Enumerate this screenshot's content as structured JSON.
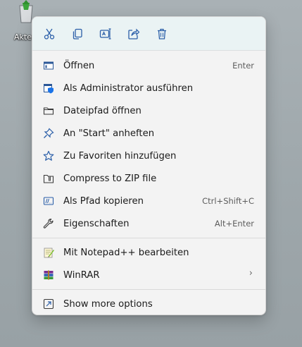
{
  "desktop_icon": {
    "label": "Akten"
  },
  "quick_actions": [
    {
      "icon": "cut-icon",
      "name": "cut"
    },
    {
      "icon": "copy-icon",
      "name": "copy"
    },
    {
      "icon": "rename-icon",
      "name": "rename"
    },
    {
      "icon": "share-icon",
      "name": "share"
    },
    {
      "icon": "delete-icon",
      "name": "delete"
    }
  ],
  "menu": {
    "group1": [
      {
        "id": "open",
        "label": "Öffnen",
        "shortcut": "Enter",
        "icon": "open-window-icon"
      },
      {
        "id": "run-as-admin",
        "label": "Als Administrator ausführen",
        "shortcut": "",
        "icon": "admin-shield-icon"
      },
      {
        "id": "open-file-path",
        "label": "Dateipfad öffnen",
        "shortcut": "",
        "icon": "folder-icon"
      },
      {
        "id": "pin-start",
        "label": "An \"Start\" anheften",
        "shortcut": "",
        "icon": "pin-icon"
      },
      {
        "id": "add-favorites",
        "label": "Zu Favoriten hinzufügen",
        "shortcut": "",
        "icon": "star-icon"
      },
      {
        "id": "compress-zip",
        "label": "Compress to ZIP file",
        "shortcut": "",
        "icon": "zip-folder-icon"
      },
      {
        "id": "copy-path",
        "label": "Als Pfad kopieren",
        "shortcut": "Ctrl+Shift+C",
        "icon": "copy-path-icon"
      },
      {
        "id": "properties",
        "label": "Eigenschaften",
        "shortcut": "Alt+Enter",
        "icon": "wrench-icon"
      }
    ],
    "group2": [
      {
        "id": "notepadpp",
        "label": "Mit Notepad++ bearbeiten",
        "shortcut": "",
        "icon": "notepadpp-icon"
      },
      {
        "id": "winrar",
        "label": "WinRAR",
        "shortcut": "",
        "icon": "winrar-icon",
        "submenu": true
      }
    ],
    "group3": [
      {
        "id": "more-options",
        "label": "Show more options",
        "shortcut": "",
        "icon": "more-options-icon"
      }
    ]
  },
  "colors": {
    "accent": "#0067c0",
    "menu_bg": "#f3f3f3",
    "quickbar_bg": "#eaf3f4"
  }
}
